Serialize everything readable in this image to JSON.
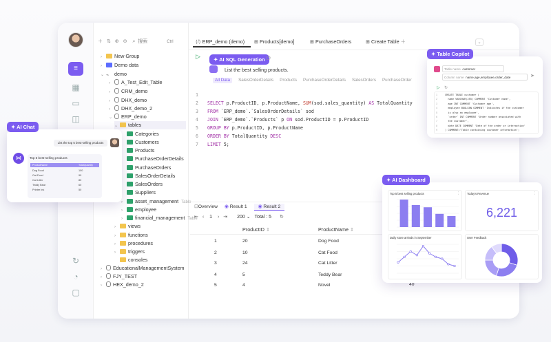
{
  "sidebar": {
    "search_placeholder": "搜索",
    "search_shortcut": "Ctrl"
  },
  "tree": {
    "items": [
      {
        "label": "New Group"
      },
      {
        "label": "Demo data"
      },
      {
        "label": "demo"
      },
      {
        "label": "A_Test_Edit_Table"
      },
      {
        "label": "CRM_demo"
      },
      {
        "label": "DHX_demo"
      },
      {
        "label": "DHX_demo_2"
      },
      {
        "label": "ERP_demo"
      },
      {
        "label": "tables"
      },
      {
        "label": "Categories"
      },
      {
        "label": "Customers"
      },
      {
        "label": "Products"
      },
      {
        "label": "PurchaseOrderDetails"
      },
      {
        "label": "PurchaseOrders"
      },
      {
        "label": "SalesOrderDetails"
      },
      {
        "label": "SalesOrders"
      },
      {
        "label": "Suppliers"
      },
      {
        "label": "asset_management",
        "suffix": "Table"
      },
      {
        "label": "employee"
      },
      {
        "label": "financial_management",
        "suffix": "Table"
      },
      {
        "label": "views"
      },
      {
        "label": "functions"
      },
      {
        "label": "procedures"
      },
      {
        "label": "triggers"
      },
      {
        "label": "consoles"
      },
      {
        "label": "EducationalManagementSystem"
      },
      {
        "label": "FJY_TEST"
      },
      {
        "label": "HEX_demo_2"
      }
    ]
  },
  "tabs": [
    {
      "label": "ERP_demo (demo)"
    },
    {
      "label": "Products[demo]"
    },
    {
      "label": "PurchaseOrders"
    },
    {
      "label": "Create Table"
    }
  ],
  "ai_sql": {
    "badge": "AI SQL Generation",
    "prompt": "List the best selling products.",
    "chips": [
      "All Data",
      "SalesOrderDetails",
      "Products",
      "PurchaseOrderDetails",
      "SalesOrders",
      "PurchaseOrder"
    ]
  },
  "editor": {
    "line_numbers": [
      "1",
      "2",
      "3",
      "4",
      "5",
      "6",
      "7"
    ],
    "line2_a": "SELECT",
    "line2_b": " p.ProductID, p.ProductName, ",
    "line2_c": "SUM",
    "line2_d": "(sod.sales_quantity) ",
    "line2_e": "AS",
    "line2_f": " TotalQuantity",
    "line3_a": "FROM",
    "line3_b": " `ERP_demo`.`SalesOrderDetails` sod",
    "line4_a": "JOIN",
    "line4_b": " `ERP_demo`.`Products` p ",
    "line4_c": "ON",
    "line4_d": " sod.ProductID = p.ProductID",
    "line5_a": "GROUP BY",
    "line5_b": " p.ProductID, p.ProductName",
    "line6_a": "ORDER BY",
    "line6_b": " TotalQuantity ",
    "line6_c": "DESC",
    "line7_a": "LIMIT",
    "line7_b": " 5;"
  },
  "results": {
    "tabs": [
      "Overview",
      "Result 1",
      "Result 2"
    ],
    "page": "1",
    "page_size": "200",
    "total": "Total : 5",
    "columns": [
      "ProductID",
      "ProductName"
    ],
    "rows": [
      [
        "1",
        "20",
        "Dog Food"
      ],
      [
        "2",
        "10",
        "Cat Food"
      ],
      [
        "3",
        "24",
        "Cat Litter"
      ],
      [
        "4",
        "5",
        "Teddy Bear"
      ],
      [
        "5",
        "4",
        "Novel"
      ]
    ],
    "extra_value": "40"
  },
  "ai_chat": {
    "badge": "AI Chat",
    "user_message": "List the top 5 best-selling products",
    "reply_title": "Top 5 best-selling products",
    "table_headers": [
      "ProductName",
      "TotalQuantity"
    ],
    "table_rows": [
      [
        "Dog Food",
        "100"
      ],
      [
        "Cat Food",
        "90"
      ],
      [
        "Cat Litter",
        "80"
      ],
      [
        "Teddy Bear",
        "60"
      ],
      [
        "Printer Ink",
        "50"
      ]
    ]
  },
  "copilot": {
    "badge": "Table Copilot",
    "field1_label": "Table name",
    "field1_value": "customer",
    "field2_label": "Column name",
    "field2_value": "name,age,employee,order_date",
    "code": [
      "CREATE TABLE customer (",
      "  name VARCHAR(255) COMMENT 'Customer name',",
      "  age INT COMMENT 'Customer age',",
      "  employee BOOLEAN COMMENT 'Indicates if the customer",
      "  is also an employee',",
      "  `order` INT COMMENT 'Order number associated with",
      "  the customer',",
      "  date DATE COMMENT 'Date of the order or interaction'",
      ") COMMENT='Table containing customer information';"
    ]
  },
  "dashboard": {
    "badge": "AI Dashboard",
    "bar_title": "Top 5 best selling products",
    "revenue_title": "Today's Revenue",
    "revenue_value": "6,221",
    "line_title": "Daily store arrivals in September",
    "donut_title": "User Feedback"
  },
  "chart_data": [
    {
      "type": "bar",
      "title": "Top 5 best selling products",
      "values": [
        100,
        80,
        72,
        48,
        40
      ],
      "color": "#8c7ef0"
    },
    {
      "type": "line",
      "title": "Daily store arrivals in September",
      "values": [
        30,
        45,
        60,
        50,
        75,
        55,
        45,
        40,
        25,
        20
      ],
      "color": "#8c7ef0"
    },
    {
      "type": "pie",
      "title": "User Feedback",
      "values": [
        30,
        25,
        20,
        15,
        10
      ],
      "colors": [
        "#6f5de8",
        "#8c7ef0",
        "#a99df5",
        "#c6befa",
        "#e0dbfc"
      ]
    }
  ],
  "colors": {
    "accent": "#7b5cf0",
    "keyword": "#a12fa6",
    "function": "#c0392b"
  }
}
